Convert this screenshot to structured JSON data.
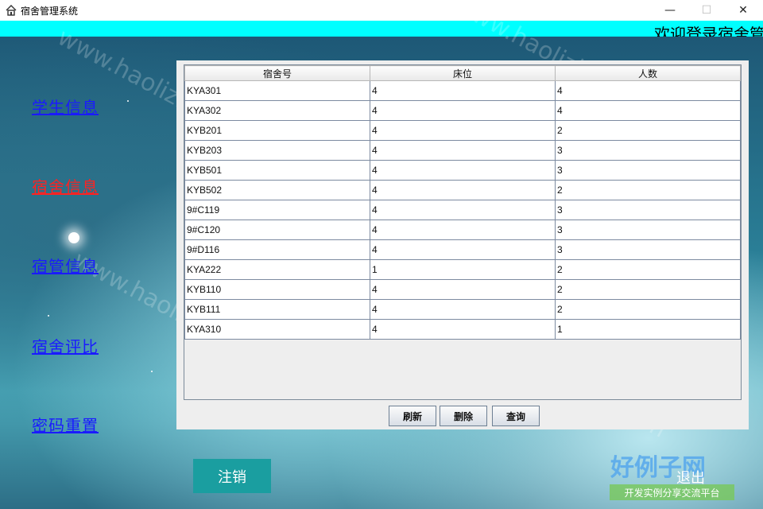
{
  "window": {
    "title": "宿舍管理系统",
    "minimize": "—",
    "maximize": "☐",
    "close": "✕"
  },
  "banner": {
    "welcome": "欢迎登录宿舍管"
  },
  "nav": [
    {
      "label": "学生信息",
      "active": false
    },
    {
      "label": "宿舍信息",
      "active": true
    },
    {
      "label": "宿管信息",
      "active": false
    },
    {
      "label": "宿舍评比",
      "active": false
    },
    {
      "label": "密码重置",
      "active": false
    }
  ],
  "table": {
    "columns": [
      "宿舍号",
      "床位",
      "人数"
    ],
    "rows": [
      [
        "KYA301",
        "4",
        "4"
      ],
      [
        "KYA302",
        "4",
        "4"
      ],
      [
        "KYB201",
        "4",
        "2"
      ],
      [
        "KYB203",
        "4",
        "3"
      ],
      [
        "KYB501",
        "4",
        "3"
      ],
      [
        "KYB502",
        "4",
        "2"
      ],
      [
        "9#C119",
        "4",
        "3"
      ],
      [
        "9#C120",
        "4",
        "3"
      ],
      [
        "9#D116",
        "4",
        "3"
      ],
      [
        "KYA222",
        "1",
        "2"
      ],
      [
        "KYB110",
        "4",
        "2"
      ],
      [
        "KYB111",
        "4",
        "2"
      ],
      [
        "KYA310",
        "4",
        "1"
      ]
    ]
  },
  "actions": {
    "refresh": "刷新",
    "delete": "删除",
    "query": "查询"
  },
  "footer": {
    "logout": "注销",
    "exit": "退出"
  },
  "watermark": {
    "text": "www.haolizi.com",
    "logo": "好例子网",
    "logo_sub": "开发实例分享交流平台"
  },
  "colors": {
    "banner": "#00ffff",
    "active_nav": "#ff2222",
    "nav": "#1a1aff",
    "logout_bg": "#1a9ea0"
  }
}
